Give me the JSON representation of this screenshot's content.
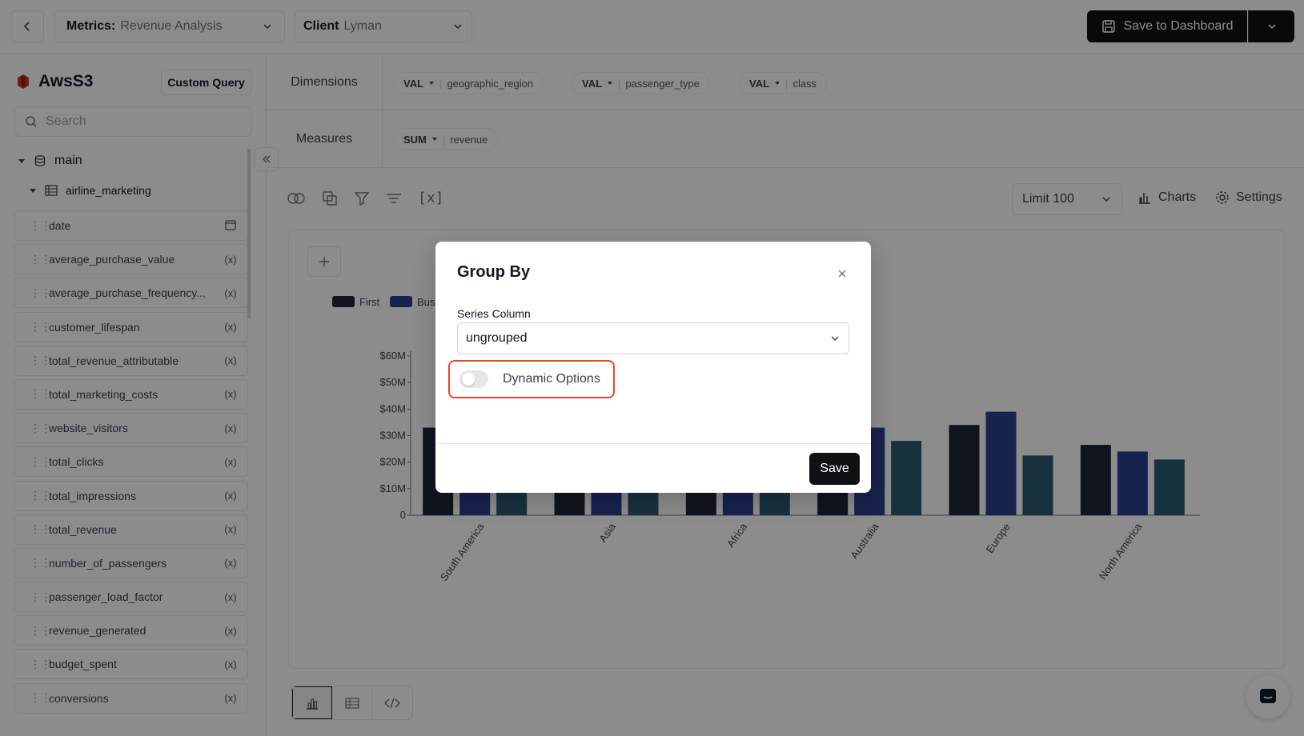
{
  "header": {
    "metrics_label": "Metrics:",
    "metrics_value": "Revenue Analysis",
    "client_label": "Client",
    "client_value": "Lyman",
    "save_dashboard": "Save to Dashboard"
  },
  "sidebar": {
    "source_name": "AwsS3",
    "custom_query": "Custom Query",
    "search_placeholder": "Search",
    "schema": "main",
    "table": "airline_marketing",
    "fields": [
      {
        "name": "date",
        "type": "calendar"
      },
      {
        "name": "average_purchase_value",
        "type": "(x)"
      },
      {
        "name": "average_purchase_frequency...",
        "type": "(x)"
      },
      {
        "name": "customer_lifespan",
        "type": "(x)"
      },
      {
        "name": "total_revenue_attributable",
        "type": "(x)"
      },
      {
        "name": "total_marketing_costs",
        "type": "(x)"
      },
      {
        "name": "website_visitors",
        "type": "(x)"
      },
      {
        "name": "total_clicks",
        "type": "(x)"
      },
      {
        "name": "total_impressions",
        "type": "(x)"
      },
      {
        "name": "total_revenue",
        "type": "(x)"
      },
      {
        "name": "number_of_passengers",
        "type": "(x)"
      },
      {
        "name": "passenger_load_factor",
        "type": "(x)"
      },
      {
        "name": "revenue_generated",
        "type": "(x)"
      },
      {
        "name": "budget_spent",
        "type": "(x)"
      },
      {
        "name": "conversions",
        "type": "(x)"
      }
    ]
  },
  "query": {
    "dimensions_label": "Dimensions",
    "dimensions": [
      {
        "agg": "VAL",
        "field": "geographic_region"
      },
      {
        "agg": "VAL",
        "field": "passenger_type"
      },
      {
        "agg": "VAL",
        "field": "class"
      }
    ],
    "measures_label": "Measures",
    "measures": [
      {
        "agg": "SUM",
        "field": "revenue"
      }
    ]
  },
  "toolbar": {
    "limit": "Limit 100",
    "charts": "Charts",
    "settings": "Settings",
    "variables_icon": "[x]"
  },
  "chart_data": {
    "type": "bar",
    "categories": [
      "South America",
      "Asia",
      "Africa",
      "Australia",
      "Europe",
      "North America"
    ],
    "series": [
      {
        "name": "First",
        "color": "#1e2636",
        "values": [
          33,
          31,
          30,
          33,
          34,
          26.5
        ]
      },
      {
        "name": "Bus",
        "color": "#2c3e8f",
        "values": [
          30,
          31,
          31,
          33,
          39,
          24
        ]
      },
      {
        "name": "",
        "color": "#2d5a73",
        "values": [
          28,
          30,
          29,
          28,
          22.5,
          21
        ]
      }
    ],
    "y_ticks": [
      "0",
      "$10M",
      "$20M",
      "$30M",
      "$40M",
      "$50M",
      "$60M"
    ],
    "ylim": [
      0,
      60
    ],
    "legend": "top-left"
  },
  "modal": {
    "title": "Group By",
    "series_label": "Series Column",
    "series_value": "ungrouped",
    "dynamic_label": "Dynamic Options",
    "dynamic_enabled": false,
    "save": "Save"
  },
  "colors": {
    "primary": "#0f1115",
    "highlight": "#e5482f",
    "overlay": "rgba(0,0,0,0.45)"
  }
}
